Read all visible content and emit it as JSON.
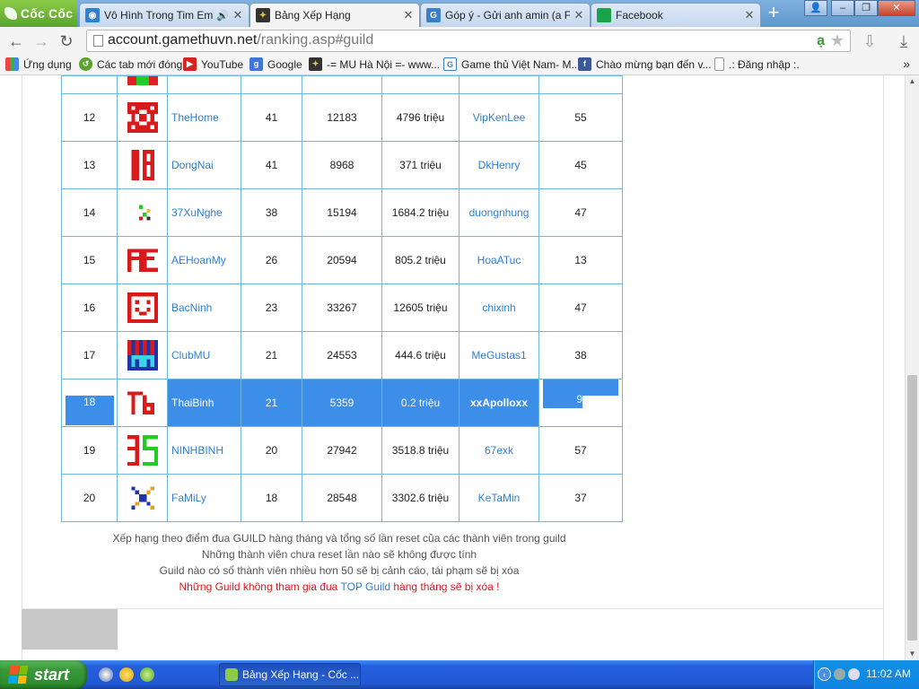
{
  "browser": {
    "brand": "Cốc Cốc",
    "tabs": [
      {
        "title": "Vô Hình Trong Tim Em - Mr",
        "favicon": "video-icon",
        "audio": true,
        "active": false
      },
      {
        "title": "Bảng Xếp Hạng",
        "favicon": "game-icon",
        "audio": false,
        "active": true
      },
      {
        "title": "Góp ý - Gửi anh amin (a Fan)",
        "favicon": "g-icon",
        "audio": false,
        "active": false
      },
      {
        "title": "Facebook",
        "favicon": "facebook-icon",
        "audio": false,
        "active": false
      }
    ],
    "url_domain": "account.gamethuvn.net",
    "url_path": "/ranking.asp#guild",
    "bookmarks": [
      {
        "label": "Ứng dụng",
        "icon": "apps-grid-icon"
      },
      {
        "label": "Các tab mới đóng",
        "icon": "history-icon"
      },
      {
        "label": "YouTube",
        "icon": "youtube-icon"
      },
      {
        "label": "Google",
        "icon": "google-icon"
      },
      {
        "label": "-= MU Hà Nội =- www...",
        "icon": "game-icon"
      },
      {
        "label": "Game thủ Việt Nam- M...",
        "icon": "g-icon"
      },
      {
        "label": "Chào mừng bạn đến v...",
        "icon": "facebook-icon"
      },
      {
        "label": ".: Đăng nhập :.",
        "icon": "page-icon"
      }
    ]
  },
  "ranking": {
    "rows": [
      {
        "rank": "12",
        "logo": "thehome",
        "name": "TheHome",
        "members": "41",
        "points": "12183",
        "zen": "4796 triệu",
        "master": "VipKenLee",
        "resets": "55"
      },
      {
        "rank": "13",
        "logo": "dongnai",
        "name": "DongNai",
        "members": "41",
        "points": "8968",
        "zen": "371 triệu",
        "master": "DkHenry",
        "resets": "45"
      },
      {
        "rank": "14",
        "logo": "37xunghe",
        "name": "37XuNghe",
        "members": "38",
        "points": "15194",
        "zen": "1684.2 triệu",
        "master": "duongnhung",
        "resets": "47"
      },
      {
        "rank": "15",
        "logo": "aehoanmy",
        "name": "AEHoanMy",
        "members": "26",
        "points": "20594",
        "zen": "805.2 triệu",
        "master": "HoaATuc",
        "resets": "13"
      },
      {
        "rank": "16",
        "logo": "bacninh",
        "name": "BacNinh",
        "members": "23",
        "points": "33267",
        "zen": "12605 triệu",
        "master": "chixinh",
        "resets": "47"
      },
      {
        "rank": "17",
        "logo": "clubmu",
        "name": "ClubMU",
        "members": "21",
        "points": "24553",
        "zen": "444.6 triệu",
        "master": "MeGustas1",
        "resets": "38"
      },
      {
        "rank": "18",
        "logo": "thaibinh",
        "name": "ThaiBinh",
        "members": "21",
        "points": "5359",
        "zen": "0.2 triệu",
        "master": "xxApolloxx",
        "resets": "9",
        "highlighted": true
      },
      {
        "rank": "19",
        "logo": "ninhbinh",
        "name": "NINHBINH",
        "members": "20",
        "points": "27942",
        "zen": "3518.8 triệu",
        "master": "67exk",
        "resets": "57"
      },
      {
        "rank": "20",
        "logo": "family",
        "name": "FaMiLy",
        "members": "18",
        "points": "28548",
        "zen": "3302.6 triệu",
        "master": "KeTaMin",
        "resets": "37"
      }
    ],
    "notes": [
      "Xếp hạng theo điểm đua GUILD hàng tháng và tổng số lần reset của các thành viên trong guild",
      "Những thành viên chưa reset lần nào sẽ không được tính",
      "Guild nào có số thành viên nhiều hơn 50 sẽ bị cảnh cáo, tái phạm sẽ bị xóa"
    ],
    "warning": {
      "part1": "Những Guild không tham gia đua ",
      "link": "TOP Guild",
      "part2": " hàng tháng sẽ bị xóa !"
    }
  },
  "taskbar": {
    "start_label": "start",
    "task_item": "Bảng Xếp Hạng - Cốc ...",
    "clock": "11:02 AM"
  },
  "colors": {
    "highlight": "#3c8ee8",
    "link": "#2f7fd3",
    "table_border": "#6fb7e0",
    "warning": "#e0161e"
  }
}
